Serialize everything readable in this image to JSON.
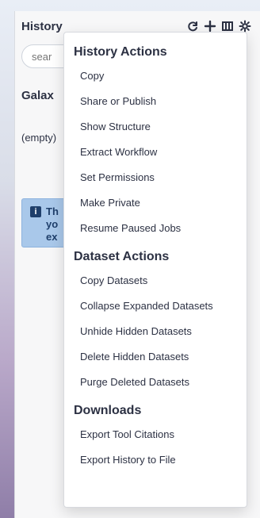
{
  "top_bleed_text": "",
  "history_panel": {
    "title": "History",
    "search_placeholder": "sear",
    "history_name_partial": "Galax",
    "empty_partial": "(empty)",
    "alert": {
      "icon": "i",
      "lines": [
        "Th",
        "yo",
        "ex"
      ]
    }
  },
  "menu": {
    "sections": [
      {
        "title": "History Actions",
        "items": [
          "Copy",
          "Share or Publish",
          "Show Structure",
          "Extract Workflow",
          "Set Permissions",
          "Make Private",
          "Resume Paused Jobs"
        ]
      },
      {
        "title": "Dataset Actions",
        "items": [
          "Copy Datasets",
          "Collapse Expanded Datasets",
          "Unhide Hidden Datasets",
          "Delete Hidden Datasets",
          "Purge Deleted Datasets"
        ]
      },
      {
        "title": "Downloads",
        "items": [
          "Export Tool Citations",
          "Export History to File"
        ]
      }
    ]
  }
}
